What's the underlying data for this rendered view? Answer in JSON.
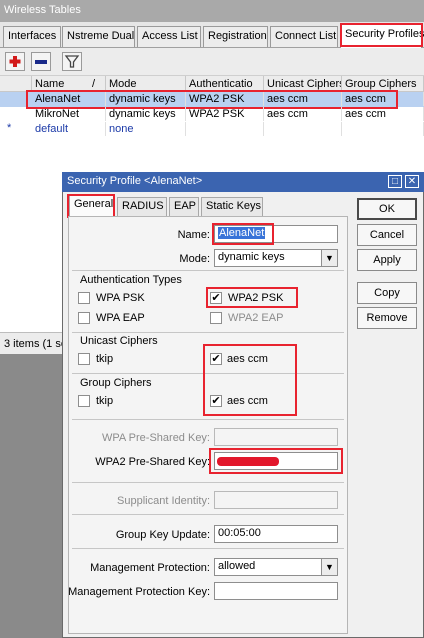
{
  "window": {
    "title": "Wireless Tables"
  },
  "tabs": [
    "Interfaces",
    "Nstreme Dual",
    "Access List",
    "Registration",
    "Connect List",
    "Security Profiles"
  ],
  "toolbar": {
    "add": "add-icon",
    "remove": "remove-icon",
    "filter": "filter-icon"
  },
  "table": {
    "columns": [
      "Name",
      "Mode",
      "Authenticatio",
      "Unicast Ciphers",
      "Group Ciphers"
    ],
    "sort_indicator": "/",
    "rows": [
      {
        "marker": "",
        "name": "AlenaNet",
        "mode": "dynamic keys",
        "auth": "WPA2 PSK",
        "unicast": "aes ccm",
        "group": "aes ccm"
      },
      {
        "marker": "",
        "name": "MikroNet",
        "mode": "dynamic keys",
        "auth": "WPA2 PSK",
        "unicast": "aes ccm",
        "group": "aes ccm"
      },
      {
        "marker": "*",
        "name": "default",
        "mode": "none",
        "auth": "",
        "unicast": "",
        "group": ""
      }
    ]
  },
  "status": {
    "text": "3 items (1 se"
  },
  "dialog": {
    "title": "Security Profile <AlenaNet>",
    "win_restore": "□",
    "win_close": "✕",
    "tabs": [
      "General",
      "RADIUS",
      "EAP",
      "Static Keys"
    ],
    "buttons": {
      "ok": "OK",
      "cancel": "Cancel",
      "apply": "Apply",
      "copy": "Copy",
      "remove": "Remove"
    },
    "name": {
      "label": "Name:",
      "value": "AlenaNet"
    },
    "mode": {
      "label": "Mode:",
      "value": "dynamic keys",
      "arrow": "▼"
    },
    "auth_types": {
      "title": "Authentication Types",
      "wpa_psk": {
        "label": "WPA PSK",
        "checked": false
      },
      "wpa2_psk": {
        "label": "WPA2 PSK",
        "checked": true
      },
      "wpa_eap": {
        "label": "WPA EAP",
        "checked": false
      },
      "wpa2_eap": {
        "label": "WPA2 EAP",
        "checked": false
      }
    },
    "unicast": {
      "title": "Unicast Ciphers",
      "tkip": "tkip",
      "aes": "aes ccm"
    },
    "group": {
      "title": "Group Ciphers",
      "tkip": "tkip",
      "aes": "aes ccm"
    },
    "checkmark": "✔",
    "wpa_key": {
      "label": "WPA Pre-Shared Key:"
    },
    "wpa2_key": {
      "label": "WPA2 Pre-Shared Key:"
    },
    "supplicant": {
      "label": "Supplicant Identity:"
    },
    "group_key_update": {
      "label": "Group Key Update:",
      "value": "00:05:00"
    },
    "mgmt_protection": {
      "label": "Management Protection:",
      "value": "allowed",
      "arrow": "▼"
    },
    "mgmt_key": {
      "label": "Management Protection Key:"
    }
  },
  "colors": {
    "highlight": "#e8232f",
    "title_bar": "#3b64b0",
    "selection": "#b9d1f1"
  }
}
